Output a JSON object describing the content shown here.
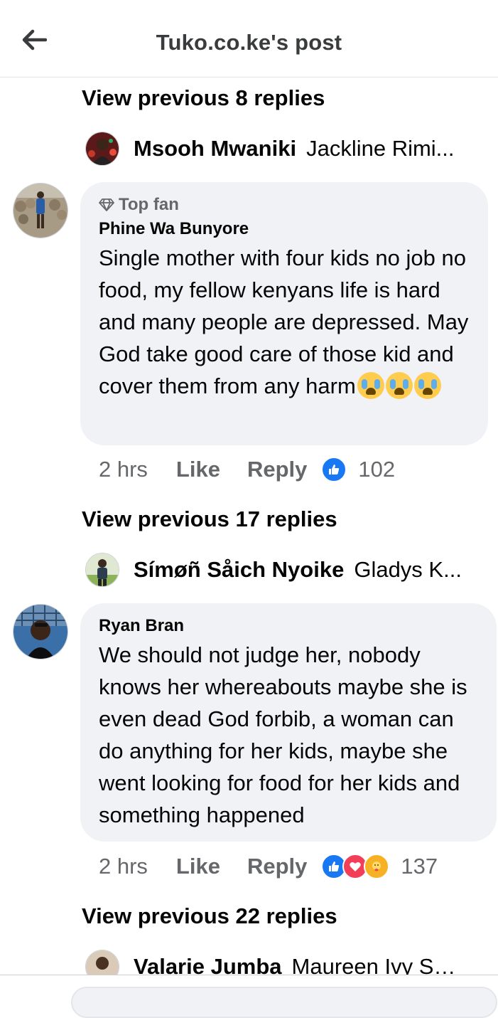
{
  "header": {
    "title": "Tuko.co.ke's post"
  },
  "threads": [
    {
      "view_previous": "View previous 8 replies",
      "collapsed_name": "Msooh Mwaniki",
      "collapsed_text": "Jackline Rimi..."
    },
    {
      "view_previous": "View previous 17 replies",
      "collapsed_name": "Símøñ Såich Nyoike",
      "collapsed_text": "Gladys K..."
    },
    {
      "view_previous": "View previous 22 replies",
      "collapsed_name": "Valarie Jumba",
      "collapsed_text": "Maureen Ivy Sh..."
    }
  ],
  "comments": [
    {
      "badge": "Top fan",
      "author": "Phine Wa Bunyore",
      "text": "Single mother with four kids no job no food, my fellow kenyans life is hard and many people are depressed. May God take good care of those kid and cover them from any harm",
      "emojis": [
        "loudly-crying-face",
        "loudly-crying-face",
        "loudly-crying-face"
      ],
      "time": "2 hrs",
      "like_label": "Like",
      "reply_label": "Reply",
      "reactions": [
        "like"
      ],
      "reaction_count": "102"
    },
    {
      "author": "Ryan Bran",
      "text": "We should not judge her, nobody knows her whereabouts maybe she is even dead God forbib, a woman can do anything for her kids, maybe she went looking for food for her kids and something happened",
      "time": "2 hrs",
      "like_label": "Like",
      "reply_label": "Reply",
      "reactions": [
        "like",
        "love",
        "care"
      ],
      "reaction_count": "137"
    }
  ],
  "colors": {
    "like_blue": "#1877f2",
    "love_red": "#f33e58",
    "care_yellow": "#f7b125",
    "bubble_gray": "#f0f2f5",
    "secondary_text": "#65676b"
  }
}
